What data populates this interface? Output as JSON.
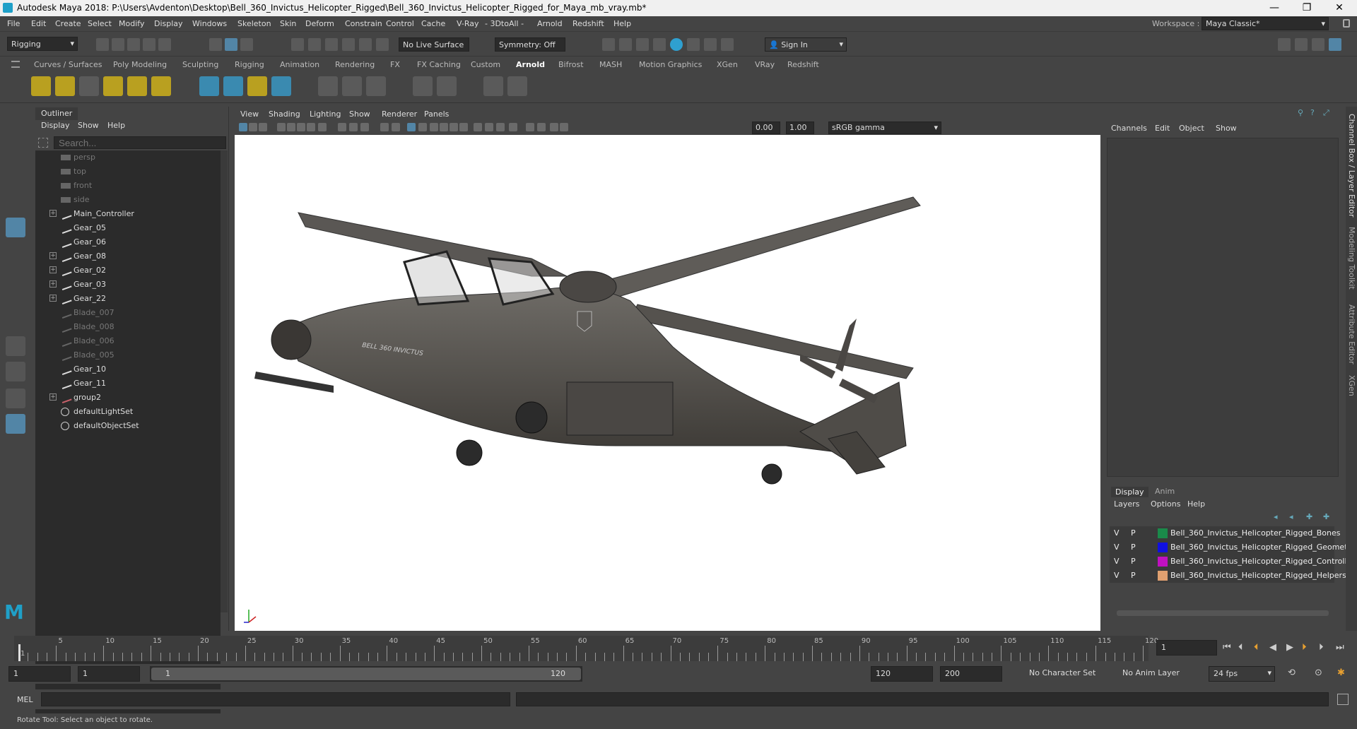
{
  "window": {
    "title": "Autodesk Maya 2018: P:\\Users\\Avdenton\\Desktop\\Bell_360_Invictus_Helicopter_Rigged\\Bell_360_Invictus_Helicopter_Rigged_for_Maya_mb_vray.mb*",
    "min": "—",
    "max": "❐",
    "close": "✕"
  },
  "menu": [
    "File",
    "Edit",
    "Create",
    "Select",
    "Modify",
    "Display",
    "Windows",
    "Skeleton",
    "Skin",
    "Deform",
    "Constrain",
    "Control",
    "Cache",
    "V-Ray",
    "- 3DtoAll -",
    "Arnold",
    "Redshift",
    "Help"
  ],
  "workspace": {
    "label": "Workspace :",
    "value": "Maya Classic*"
  },
  "toolbar": {
    "mode": "Rigging",
    "live_surface": "No Live Surface",
    "symmetry": "Symmetry: Off",
    "sign_in": "Sign In"
  },
  "shelf_tabs": [
    "Curves / Surfaces",
    "Poly Modeling",
    "Sculpting",
    "Rigging",
    "Animation",
    "Rendering",
    "FX",
    "FX Caching",
    "Custom",
    "Arnold",
    "Bifrost",
    "MASH",
    "Motion Graphics",
    "XGen",
    "VRay",
    "Redshift"
  ],
  "shelf_active": "Arnold",
  "outliner": {
    "title": "Outliner",
    "menus": [
      "Display",
      "Show",
      "Help"
    ],
    "search_placeholder": "Search...",
    "items": [
      {
        "label": "persp",
        "type": "camera",
        "dim": true,
        "expand": false
      },
      {
        "label": "top",
        "type": "camera",
        "dim": true,
        "expand": false
      },
      {
        "label": "front",
        "type": "camera",
        "dim": true,
        "expand": false
      },
      {
        "label": "side",
        "type": "camera",
        "dim": true,
        "expand": false
      },
      {
        "label": "Main_Controller",
        "type": "transform",
        "dim": false,
        "expand": true
      },
      {
        "label": "Gear_05",
        "type": "transform",
        "dim": false,
        "expand": false
      },
      {
        "label": "Gear_06",
        "type": "transform",
        "dim": false,
        "expand": false
      },
      {
        "label": "Gear_08",
        "type": "transform",
        "dim": false,
        "expand": true
      },
      {
        "label": "Gear_02",
        "type": "transform",
        "dim": false,
        "expand": true
      },
      {
        "label": "Gear_03",
        "type": "transform",
        "dim": false,
        "expand": true
      },
      {
        "label": "Gear_22",
        "type": "transform",
        "dim": false,
        "expand": true
      },
      {
        "label": "Blade_007",
        "type": "transform",
        "dim": true,
        "expand": false
      },
      {
        "label": "Blade_008",
        "type": "transform",
        "dim": true,
        "expand": false
      },
      {
        "label": "Blade_006",
        "type": "transform",
        "dim": true,
        "expand": false
      },
      {
        "label": "Blade_005",
        "type": "transform",
        "dim": true,
        "expand": false
      },
      {
        "label": "Gear_10",
        "type": "transform",
        "dim": false,
        "expand": false
      },
      {
        "label": "Gear_11",
        "type": "transform",
        "dim": false,
        "expand": false
      },
      {
        "label": "group2",
        "type": "group",
        "dim": false,
        "expand": true
      },
      {
        "label": "defaultLightSet",
        "type": "set",
        "dim": false,
        "expand": false
      },
      {
        "label": "defaultObjectSet",
        "type": "set",
        "dim": false,
        "expand": false
      }
    ]
  },
  "viewport": {
    "menus": [
      "View",
      "Shading",
      "Lighting",
      "Show",
      "Renderer",
      "Panels"
    ],
    "field1": "0.00",
    "field2": "1.00",
    "colorspace": "sRGB gamma",
    "heli_label": "BELL 360 INVICTUS",
    "badge": "BELL"
  },
  "channelbox": {
    "menus": [
      "Channels",
      "Edit",
      "Object",
      "Show"
    ],
    "tabs": [
      "Display",
      "Anim"
    ],
    "layer_menus": [
      "Layers",
      "Options",
      "Help"
    ],
    "layers": [
      {
        "v": "V",
        "p": "P",
        "name": "Bell_360_Invictus_Helicopter_Rigged_Bones",
        "color": "#1a8a4a"
      },
      {
        "v": "V",
        "p": "P",
        "name": "Bell_360_Invictus_Helicopter_Rigged_Geometr",
        "color": "#1010e0"
      },
      {
        "v": "V",
        "p": "P",
        "name": "Bell_360_Invictus_Helicopter_Rigged_Controll",
        "color": "#c010c0"
      },
      {
        "v": "V",
        "p": "P",
        "name": "Bell_360_Invictus_Helicopter_Rigged_Helpers",
        "color": "#e0a070"
      }
    ]
  },
  "right_tabs": [
    "Channel Box / Layer Editor",
    "Modeling Toolkit",
    "Attribute Editor",
    "XGen"
  ],
  "timeline": {
    "ticks": [
      1,
      5,
      10,
      15,
      20,
      25,
      30,
      35,
      40,
      45,
      50,
      55,
      60,
      65,
      70,
      75,
      80,
      85,
      90,
      95,
      100,
      105,
      110,
      115,
      120
    ],
    "current": "1",
    "max_frame": 120
  },
  "range": {
    "start": "1",
    "start2": "1",
    "inner_start": "1",
    "inner_end": "120",
    "end": "120",
    "end2": "200",
    "char_set": "No Character Set",
    "anim_layer": "No Anim Layer",
    "fps": "24 fps"
  },
  "cmd": {
    "label": "MEL"
  },
  "status": "Rotate Tool: Select an object to rotate."
}
